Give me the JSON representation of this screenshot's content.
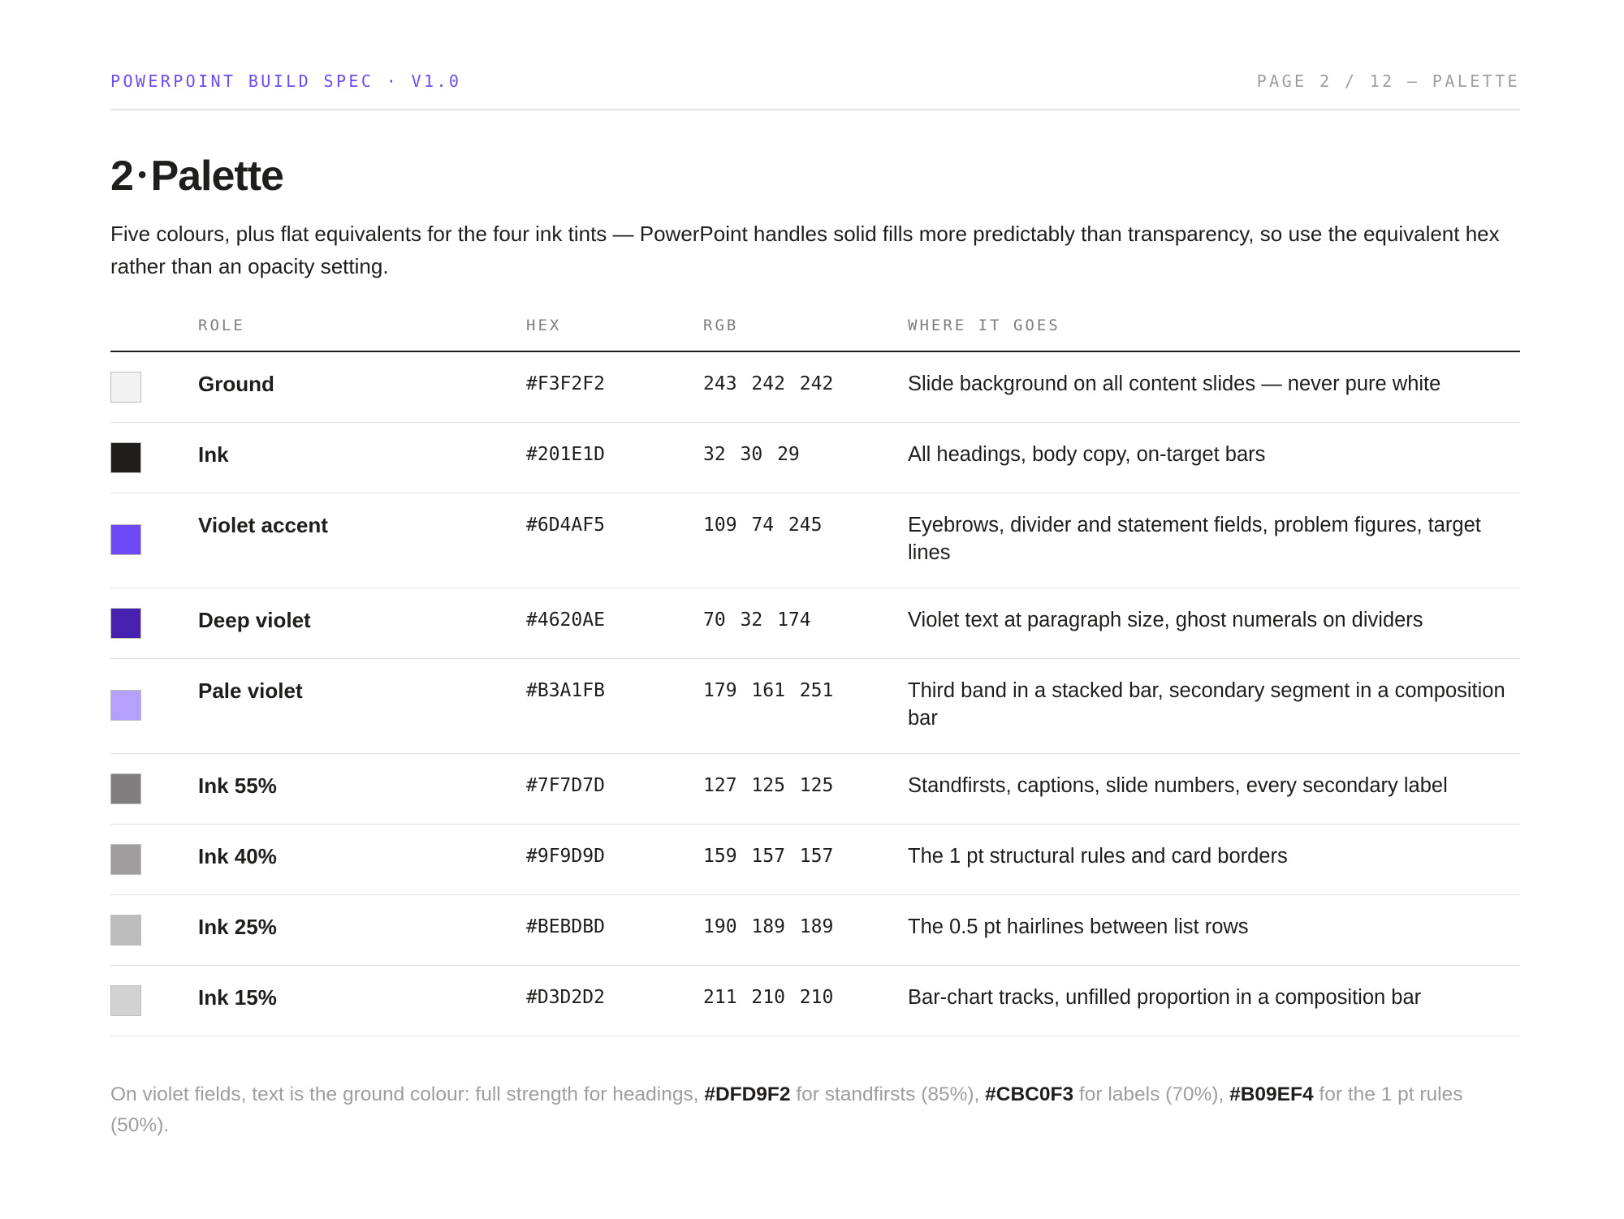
{
  "header": {
    "eyebrow": "POWERPOINT BUILD SPEC · V1.0",
    "page_marker": "PAGE 2 / 12 — PALETTE"
  },
  "section": {
    "number": "2",
    "separator": "•",
    "title": "Palette",
    "intro": "Five colours, plus flat equivalents for the four ink tints — PowerPoint handles solid fills more predictably than transparency, so use the equivalent hex rather than an opacity setting."
  },
  "table": {
    "columns": {
      "role": "ROLE",
      "hex": "HEX",
      "rgb": "RGB",
      "where": "WHERE IT GOES"
    },
    "rows": [
      {
        "role": "Ground",
        "hex": "#F3F2F2",
        "rgb": "243 242 242",
        "where": "Slide background on all content slides — never pure white",
        "swatch": "#F3F2F2"
      },
      {
        "role": "Ink",
        "hex": "#201E1D",
        "rgb": "32 30 29",
        "where": "All headings, body copy, on-target bars",
        "swatch": "#201E1D"
      },
      {
        "role": "Violet accent",
        "hex": "#6D4AF5",
        "rgb": "109 74 245",
        "where": "Eyebrows, divider and statement fields, problem figures, target lines",
        "swatch": "#6D4AF5"
      },
      {
        "role": "Deep violet",
        "hex": "#4620AE",
        "rgb": "70 32 174",
        "where": "Violet text at paragraph size, ghost numerals on dividers",
        "swatch": "#4620AE"
      },
      {
        "role": "Pale violet",
        "hex": "#B3A1FB",
        "rgb": "179 161 251",
        "where": "Third band in a stacked bar, secondary segment in a composition bar",
        "swatch": "#B3A1FB"
      },
      {
        "role": "Ink 55%",
        "hex": "#7F7D7D",
        "rgb": "127 125 125",
        "where": "Standfirsts, captions, slide numbers, every secondary label",
        "swatch": "#7F7D7D"
      },
      {
        "role": "Ink 40%",
        "hex": "#9F9D9D",
        "rgb": "159 157 157",
        "where": "The 1 pt structural rules and card borders",
        "swatch": "#9F9D9D"
      },
      {
        "role": "Ink 25%",
        "hex": "#BEBDBD",
        "rgb": "190 189 189",
        "where": "The 0.5 pt hairlines between list rows",
        "swatch": "#BEBDBD"
      },
      {
        "role": "Ink 15%",
        "hex": "#D3D2D2",
        "rgb": "211 210 210",
        "where": "Bar-chart tracks, unfilled proportion in a composition bar",
        "swatch": "#D3D2D2"
      }
    ]
  },
  "note": {
    "part1": "On violet fields, text is the ground colour: full strength for headings, ",
    "hex1": "#DFD9F2",
    "part2": " for standfirsts (85%), ",
    "hex2": "#CBC0F3",
    "part3": " for labels (70%), ",
    "hex3": "#B09EF4",
    "part4": " for the 1 pt rules (50%)."
  }
}
